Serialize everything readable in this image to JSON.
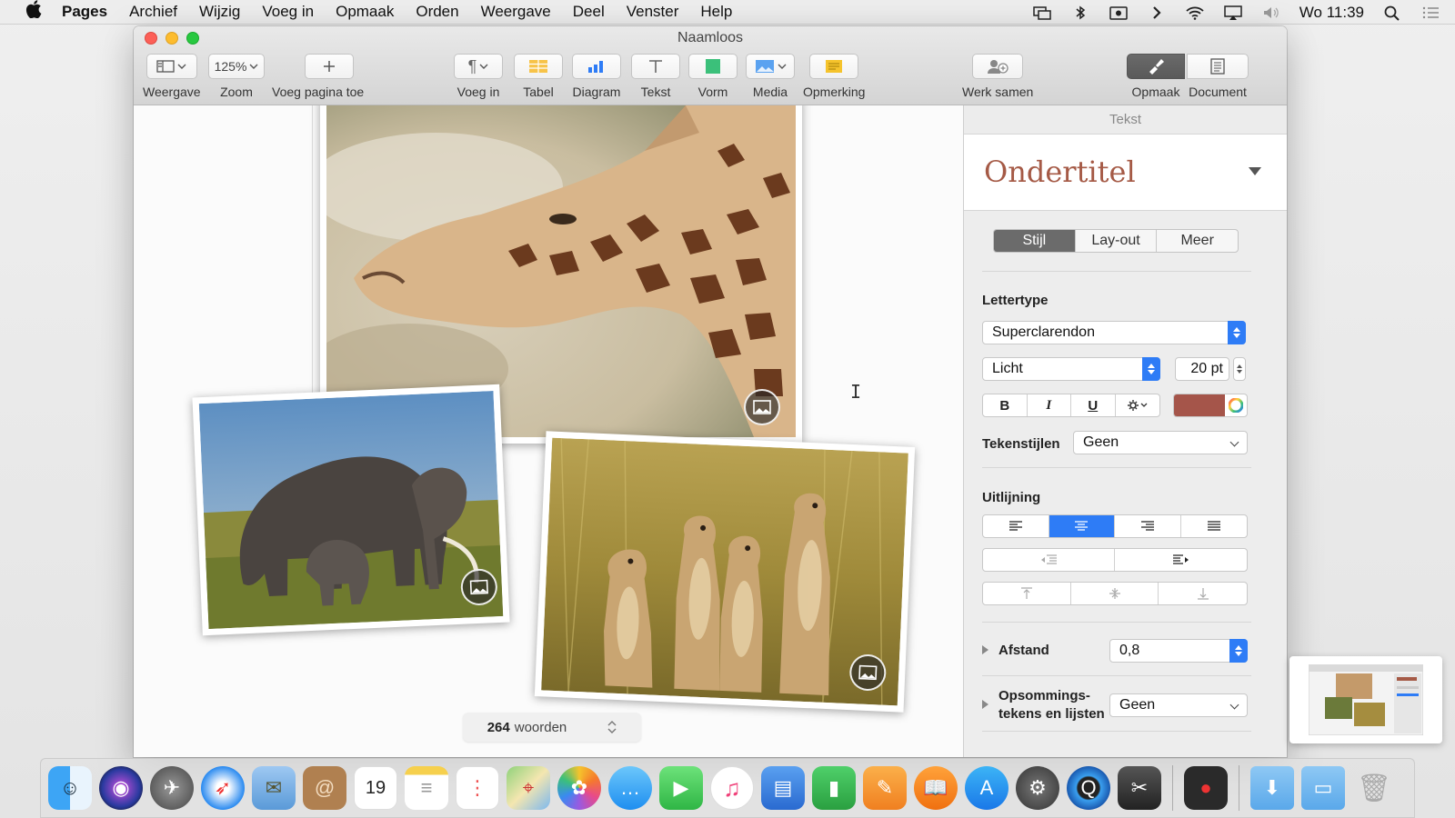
{
  "menubar": {
    "app_name": "Pages",
    "items": [
      "Archief",
      "Wijzig",
      "Voeg in",
      "Opmaak",
      "Orden",
      "Weergave",
      "Deel",
      "Venster",
      "Help"
    ],
    "clock": "Wo 11:39"
  },
  "window": {
    "title": "Naamloos"
  },
  "toolbar": {
    "view_label": "Weergave",
    "zoom_value": "125%",
    "zoom_label": "Zoom",
    "add_page_label": "Voeg pagina toe",
    "insert_label": "Voeg in",
    "table_label": "Tabel",
    "chart_label": "Diagram",
    "text_label": "Tekst",
    "shape_label": "Vorm",
    "media_label": "Media",
    "comment_label": "Opmerking",
    "collaborate_label": "Werk samen",
    "format_label": "Opmaak",
    "document_label": "Document"
  },
  "canvas": {
    "word_count": "264",
    "word_count_suffix": "woorden"
  },
  "sidebar": {
    "header": "Tekst",
    "paragraph_style": "Ondertitel",
    "tabs": [
      "Stijl",
      "Lay-out",
      "Meer"
    ],
    "active_tab": "Stijl",
    "font_section": "Lettertype",
    "font_name": "Superclarendon",
    "font_weight": "Licht",
    "font_size": "20 pt",
    "bold": "B",
    "italic": "I",
    "underline": "U",
    "text_color": "#a5554a",
    "char_styles_label": "Tekenstijlen",
    "char_styles_value": "Geen",
    "alignment_section": "Uitlijning",
    "spacing_label": "Afstand",
    "spacing_value": "0,8",
    "bullets_label_1": "Opsommings-",
    "bullets_label_2": "tekens en lijsten",
    "bullets_value": "Geen"
  },
  "colors": {
    "accent": "#2e7cf6",
    "style_title": "#a55a46"
  }
}
